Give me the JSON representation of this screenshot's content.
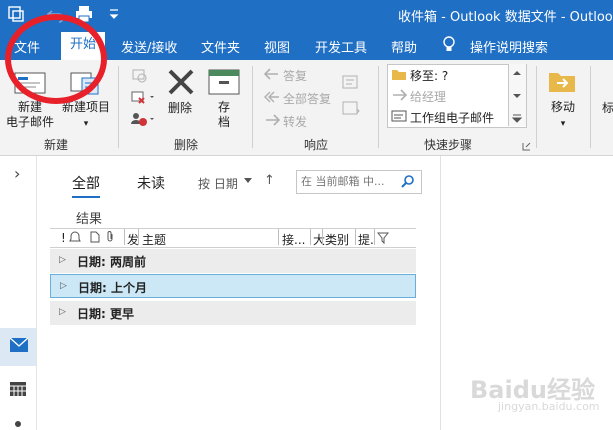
{
  "window": {
    "title": "收件箱 - Outlook 数据文件 - Outlook"
  },
  "colors": {
    "accent": "#1f6fc5",
    "selected_row": "#cce8f6",
    "annotation": "#e8202a"
  },
  "quick_access": {
    "icons": [
      "send-receive-icon",
      "undo-icon",
      "print-icon",
      "customize-icon"
    ]
  },
  "ribbon_tabs": [
    "文件",
    "开始",
    "发送/接收",
    "文件夹",
    "视图",
    "开发工具",
    "帮助"
  ],
  "tell_me": "操作说明搜索",
  "ribbon": {
    "new_group": {
      "label": "新建",
      "new_email_line1": "新建",
      "new_email_line2": "电子邮件",
      "new_item": "新建项目",
      "dropdown": "▾"
    },
    "delete_group": {
      "label": "删除",
      "delete": "删除",
      "archive_line1": "存",
      "archive_line2": "档"
    },
    "respond_group": {
      "label": "响应",
      "reply": "答复",
      "reply_all": "全部答复",
      "forward": "转发"
    },
    "quick_steps_group": {
      "label": "快速步骤",
      "move_to": "移至: ?",
      "to_manager": "给经理",
      "team_email": "工作组电子邮件"
    },
    "move_group": {
      "move": "移动",
      "cut_label": "标"
    }
  },
  "list": {
    "filters": {
      "all": "全部",
      "unread": "未读",
      "sort": "按 日期",
      "sort_arrow": "↑"
    },
    "search_placeholder": "在 当前邮箱 中...",
    "results_label": "结果",
    "columns": {
      "importance": "!",
      "reminder": "🔔",
      "icon": "🗋",
      "attachment": "📎",
      "from": "发",
      "subject": "主题",
      "received": "接...",
      "size": "大",
      "category": "类别",
      "flag": "提."
    },
    "groups": [
      "日期: 两周前",
      "日期: 上个月",
      "日期: 更早"
    ]
  },
  "left_rail": {
    "expand": "›"
  },
  "watermark": {
    "brand": "Baidu经验",
    "url": "jingyan.baidu.com"
  }
}
